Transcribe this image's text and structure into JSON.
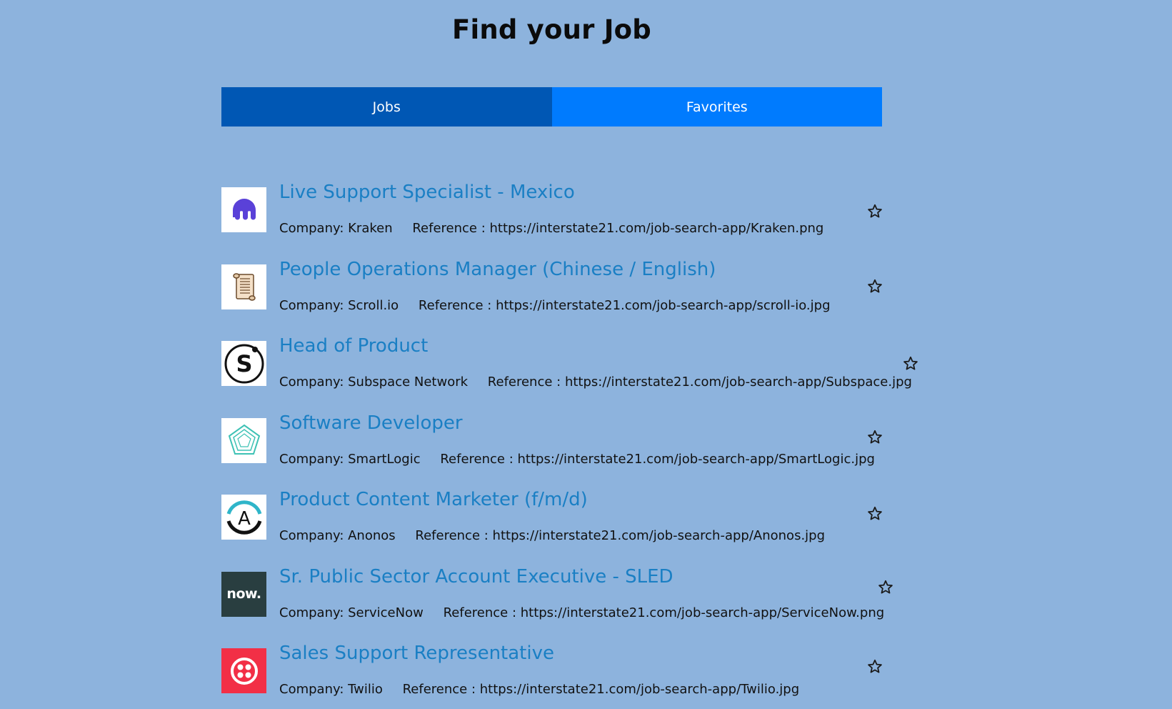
{
  "page": {
    "title": "Find your Job"
  },
  "tabs": [
    {
      "label": "Jobs",
      "active": true
    },
    {
      "label": "Favorites",
      "active": false
    }
  ],
  "company_prefix": "Company: ",
  "reference_prefix": "Reference : ",
  "jobs": [
    {
      "title": "Live Support Specialist - Mexico",
      "company": "Kraken",
      "reference": "https://interstate21.com/job-search-app/Kraken.png",
      "logo_icon": "kraken-logo-icon",
      "favorite_icon": "star-outline-icon"
    },
    {
      "title": "People Operations Manager (Chinese / English)",
      "company": "Scroll.io",
      "reference": "https://interstate21.com/job-search-app/scroll-io.jpg",
      "logo_icon": "scroll-logo-icon",
      "favorite_icon": "star-outline-icon"
    },
    {
      "title": "Head of Product",
      "company": "Subspace Network",
      "reference": "https://interstate21.com/job-search-app/Subspace.jpg",
      "logo_icon": "subspace-logo-icon",
      "favorite_icon": "star-outline-icon"
    },
    {
      "title": "Software Developer",
      "company": "SmartLogic",
      "reference": "https://interstate21.com/job-search-app/SmartLogic.jpg",
      "logo_icon": "smartlogic-logo-icon",
      "favorite_icon": "star-outline-icon"
    },
    {
      "title": "Product Content Marketer (f/m/d)",
      "company": "Anonos",
      "reference": "https://interstate21.com/job-search-app/Anonos.jpg",
      "logo_icon": "anonos-logo-icon",
      "favorite_icon": "star-outline-icon"
    },
    {
      "title": "Sr. Public Sector Account Executive - SLED",
      "company": "ServiceNow",
      "reference": "https://interstate21.com/job-search-app/ServiceNow.png",
      "logo_icon": "servicenow-logo-icon",
      "logo_text": "now.",
      "favorite_icon": "star-outline-icon"
    },
    {
      "title": "Sales Support Representative",
      "company": "Twilio",
      "reference": "https://interstate21.com/job-search-app/Twilio.jpg",
      "logo_icon": "twilio-logo-icon",
      "favorite_icon": "star-outline-icon"
    }
  ],
  "colors": {
    "background": "#8db3dd",
    "tab_active": "#0057b4",
    "tab_inactive": "#007bfe",
    "job_title": "#1a7fc4"
  }
}
